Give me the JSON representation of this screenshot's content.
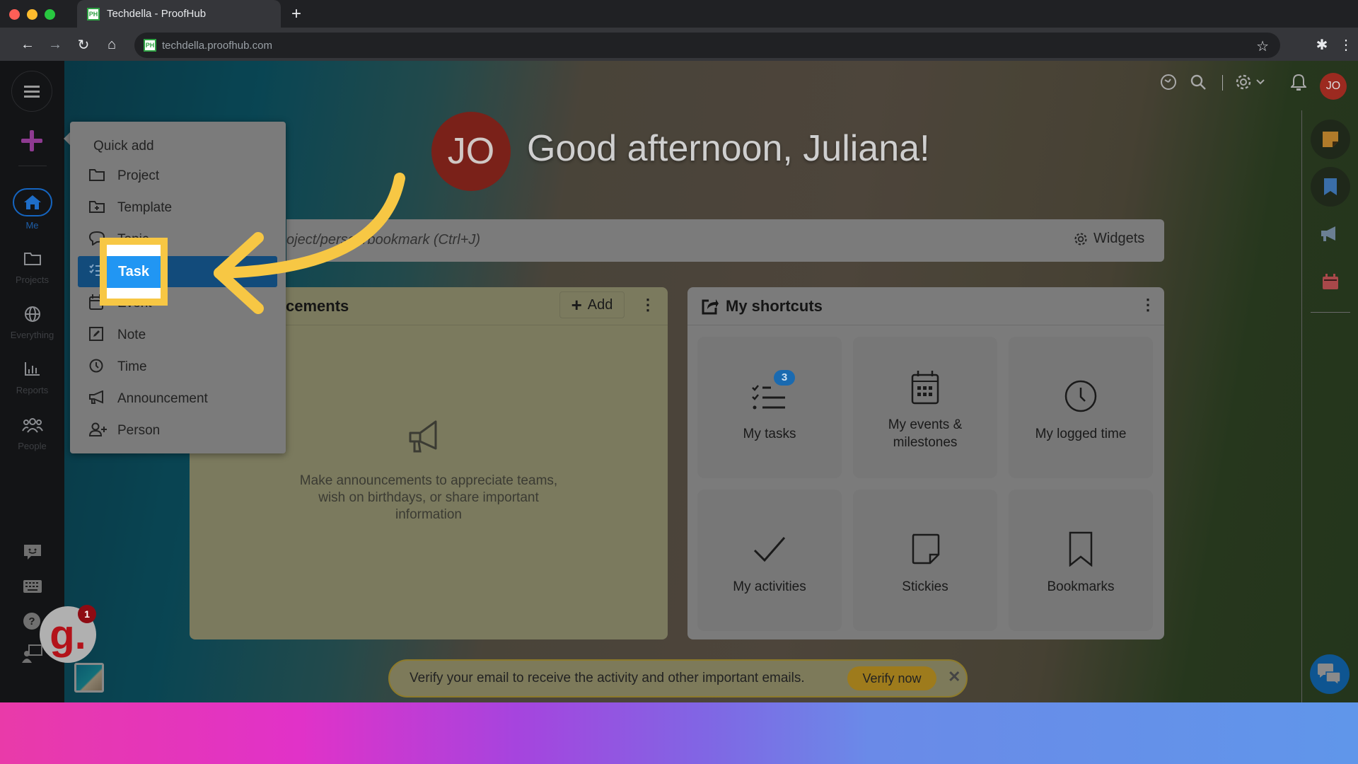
{
  "browser": {
    "tab_title": "Techdella - ProofHub",
    "favicon_text": "PH",
    "url": "techdella.proofhub.com",
    "icons": [
      "back-icon",
      "forward-icon",
      "reload-icon",
      "home-icon",
      "bookmark-star-icon",
      "extensions-icon",
      "menu-icon"
    ]
  },
  "sidebar": {
    "items": [
      {
        "label": "Me",
        "icon": "home-icon",
        "active": true
      },
      {
        "label": "Projects",
        "icon": "folder-icon"
      },
      {
        "label": "Everything",
        "icon": "globe-icon"
      },
      {
        "label": "Reports",
        "icon": "chart-icon"
      },
      {
        "label": "People",
        "icon": "people-icon"
      }
    ],
    "bottom_icons": [
      "feedback-icon",
      "keyboard-icon",
      "help-icon",
      "presentation-icon"
    ]
  },
  "quick_add": {
    "title": "Quick add",
    "items": [
      {
        "label": "Project",
        "icon": "folder-icon"
      },
      {
        "label": "Template",
        "icon": "folder-plus-icon"
      },
      {
        "label": "Topic",
        "icon": "chat-icon"
      },
      {
        "label": "Task",
        "icon": "checklist-icon",
        "active": true
      },
      {
        "label": "Event",
        "icon": "calendar-icon"
      },
      {
        "label": "Note",
        "icon": "note-icon"
      },
      {
        "label": "Time",
        "icon": "clock-icon"
      },
      {
        "label": "Announcement",
        "icon": "megaphone-icon"
      },
      {
        "label": "Person",
        "icon": "add-person-icon"
      }
    ]
  },
  "highlight": {
    "label": "Task"
  },
  "header": {
    "avatar_initials": "JO",
    "greeting": "Good afternoon, Juliana!",
    "user_initials": "JO"
  },
  "search": {
    "placeholder_visible": "oject/person/bookmark (Ctrl+J)",
    "widgets_label": "Widgets"
  },
  "announcements": {
    "title_visible": "cements",
    "add_label": "Add",
    "empty_text": "Make announcements to appreciate teams, wish on birthdays, or share important information"
  },
  "shortcuts": {
    "title": "My shortcuts",
    "tiles": [
      {
        "label": "My tasks",
        "icon": "task-list-icon",
        "badge": "3"
      },
      {
        "label": "My events & milestones",
        "icon": "calendar-icon"
      },
      {
        "label": "My logged time",
        "icon": "clock-icon"
      },
      {
        "label": "My activities",
        "icon": "checkmark-icon"
      },
      {
        "label": "Stickies",
        "icon": "sticky-note-icon"
      },
      {
        "label": "Bookmarks",
        "icon": "bookmark-icon"
      }
    ]
  },
  "verify_banner": {
    "text": "Verify your email to receive the activity and other important emails.",
    "button": "Verify now"
  },
  "guidde": {
    "logo": "g.",
    "badge": "1"
  },
  "colors": {
    "accent_blue": "#2196f3",
    "highlight_yellow": "#f7c744",
    "avatar_red": "#9c2a20",
    "menu_active": "#124b7b"
  }
}
